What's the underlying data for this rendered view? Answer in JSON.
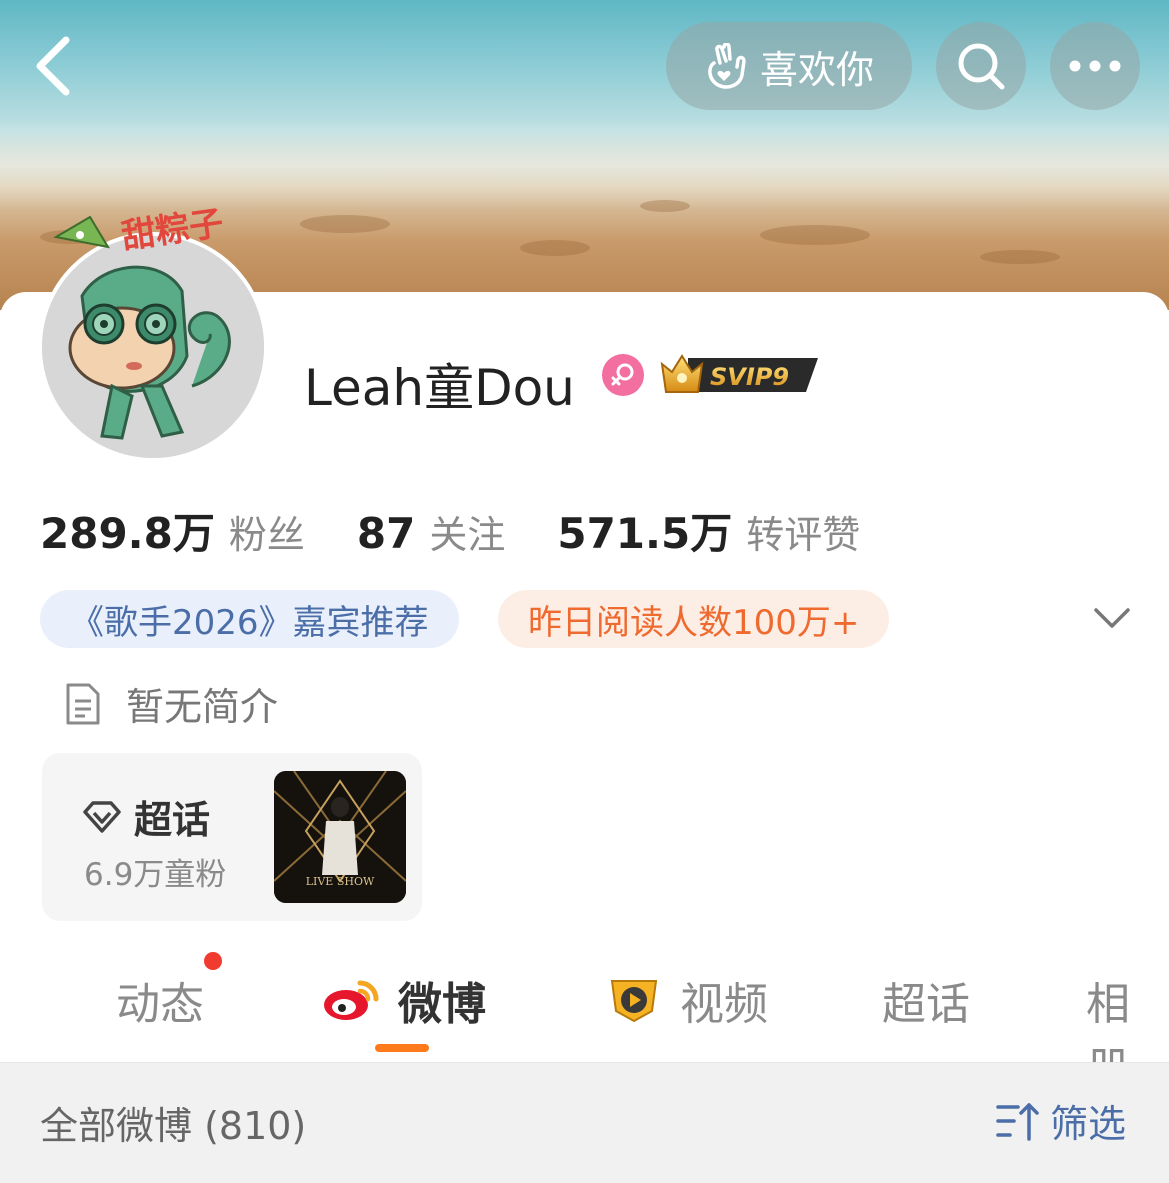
{
  "header": {
    "like_label": "喜欢你",
    "icons": [
      "back-icon",
      "hand-heart-icon",
      "search-icon",
      "more-icon"
    ]
  },
  "avatar": {
    "sticker_text": "甜粽子"
  },
  "profile": {
    "name": "Leah童Dou",
    "svip_label": "SVIP9",
    "gender": "female"
  },
  "stats": [
    {
      "value": "289.8万",
      "label": "粉丝"
    },
    {
      "value": "87",
      "label": "关注"
    },
    {
      "value": "571.5万",
      "label": "转评赞"
    }
  ],
  "tags": {
    "blue": "《歌手2026》嘉宾推荐",
    "orange": "昨日阅读人数100万+"
  },
  "bio": {
    "text": "暂无简介"
  },
  "supertopic": {
    "title": "超话",
    "subtitle": "6.9万童粉",
    "thumb_text": "LIVE SHOW"
  },
  "tabs": [
    {
      "label": "动态"
    },
    {
      "label": "微博"
    },
    {
      "label": "视频"
    },
    {
      "label": "超话"
    },
    {
      "label": "相册"
    }
  ],
  "list": {
    "title": "全部微博 (810)",
    "filter_label": "筛选"
  },
  "colors": {
    "accent_orange": "#ff7a1a",
    "link_blue": "#4b6ea8",
    "badge_red": "#f23b30",
    "gender_pink": "#f26fa0"
  }
}
